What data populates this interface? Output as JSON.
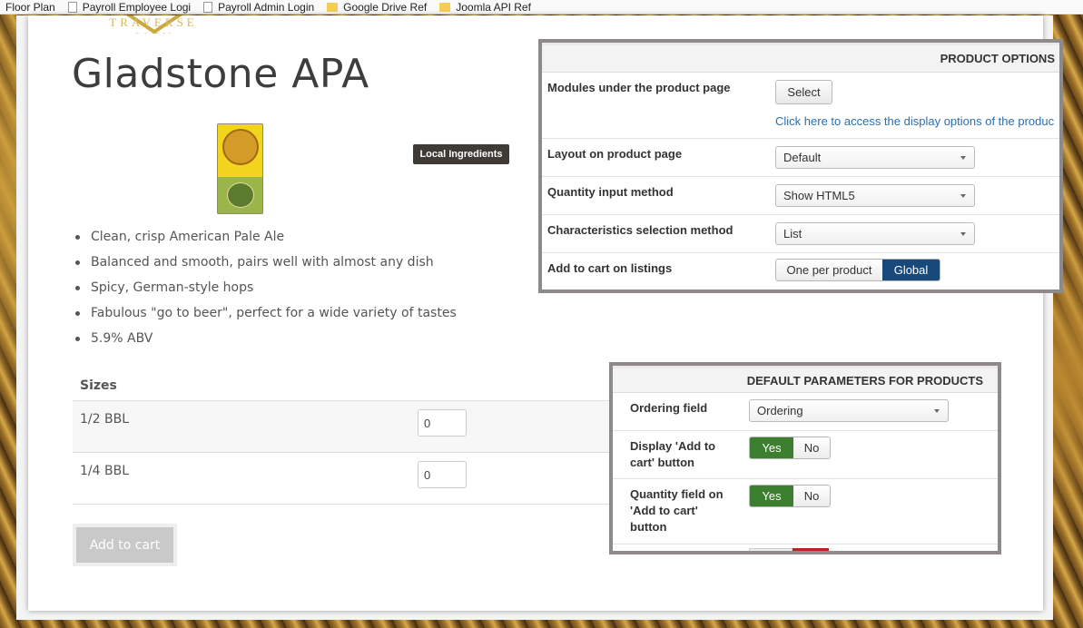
{
  "bookmarks": [
    {
      "label": "Floor Plan",
      "icon": "none"
    },
    {
      "label": "Payroll Employee Logi",
      "icon": "page-icon"
    },
    {
      "label": "Payroll Admin Login",
      "icon": "page-icon"
    },
    {
      "label": "Google Drive Ref",
      "icon": "folder-icon"
    },
    {
      "label": "Joomla API Ref",
      "icon": "folder-icon"
    }
  ],
  "logo": {
    "text": "TRAVERSE CITY"
  },
  "product": {
    "title": "Gladstone APA",
    "badge": "Local Ingredients",
    "features": [
      "Clean, crisp American Pale Ale",
      "Balanced and smooth, pairs well with almost any dish",
      "Spicy, German-style hops",
      "Fabulous \"go to beer\", perfect for a wide variety of tastes",
      "5.9% ABV"
    ]
  },
  "sizes": {
    "header": "Sizes",
    "rows": [
      {
        "label": "1/2 BBL",
        "qty": "0"
      },
      {
        "label": "1/4 BBL",
        "qty": "0"
      }
    ]
  },
  "add_to_cart": "Add to cart",
  "product_options": {
    "header": "PRODUCT OPTIONS",
    "modules_label": "Modules under the product page",
    "select_button": "Select",
    "display_link": "Click here to access the display options of the produc",
    "layout_label": "Layout on product page",
    "layout_value": "Default",
    "quantity_label": "Quantity input method",
    "quantity_value": "Show HTML5",
    "characteristics_label": "Characteristics selection method",
    "characteristics_value": "List",
    "add_cart_label": "Add to cart on listings",
    "add_cart_option1": "One per product",
    "add_cart_option2": "Global"
  },
  "default_params": {
    "header": "DEFAULT PARAMETERS FOR PRODUCTS",
    "ordering_label": "Ordering field",
    "ordering_value": "Ordering",
    "display_btn_label": "Display 'Add to cart' button",
    "qty_field_label": "Quantity field on 'Add to cart' button",
    "yes": "Yes",
    "no": "No"
  },
  "colors": {
    "accent_blue": "#17497a",
    "accent_green": "#3b7f2f",
    "link": "#2a6eb5",
    "badge_bg": "#3e3a35"
  }
}
